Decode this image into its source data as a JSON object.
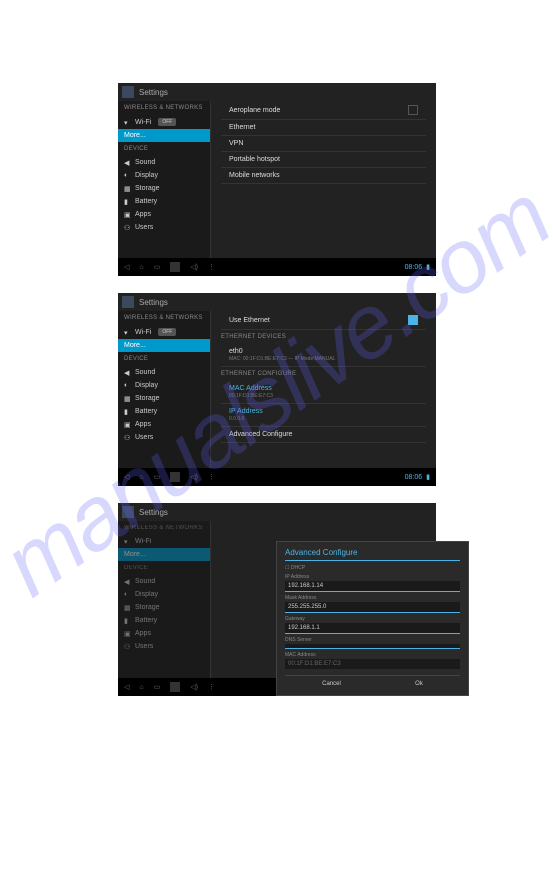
{
  "watermark": "manualslive.com",
  "header": {
    "title": "Settings"
  },
  "sidebar": {
    "section1_label": "WIRELESS & NETWORKS",
    "wifi": {
      "label": "Wi-Fi",
      "badge": "OFF"
    },
    "more": {
      "label": "More..."
    },
    "section2_label": "DEVICE",
    "sound": {
      "label": "Sound"
    },
    "display": {
      "label": "Display"
    },
    "storage": {
      "label": "Storage"
    },
    "battery": {
      "label": "Battery"
    },
    "apps": {
      "label": "Apps"
    },
    "users": {
      "label": "Users"
    }
  },
  "screen1": {
    "items": [
      {
        "label": "Aeroplane mode",
        "toggle": true
      },
      {
        "label": "Ethernet"
      },
      {
        "label": "VPN"
      },
      {
        "label": "Portable hotspot"
      },
      {
        "label": "Mobile networks"
      }
    ]
  },
  "screen2": {
    "use_ethernet": "Use Ethernet",
    "devices_label": "ETHERNET DEVICES",
    "eth0": {
      "name": "eth0",
      "sub": "MAC: 00:1F:D1:BE:E7:C3 — IP Mode:MANUAL"
    },
    "configure_label": "ETHERNET CONFIGURE",
    "mac": {
      "label": "MAC Address",
      "value": "00:1F:D1:BE:E7:C3"
    },
    "ip": {
      "label": "IP Address",
      "value": "0.0.0.0"
    },
    "adv": "Advanced Configure"
  },
  "screen3": {
    "title": "Advanced Configure",
    "dhcp": "DHCP",
    "ip_label": "IP Address",
    "ip_value": "192.168.1.14",
    "mask_label": "Mask Address",
    "mask_value": "255.255.255.0",
    "gw_label": "Gateway",
    "gw_value": "192.168.1.1",
    "dns_label": "DNS Server",
    "dns_value": "",
    "mac_label": "MAC Address",
    "mac_value": "00:1F:D1:BE:E7:C3",
    "cancel": "Cancel",
    "ok": "Ok"
  },
  "nav": {
    "time": "08:06"
  }
}
